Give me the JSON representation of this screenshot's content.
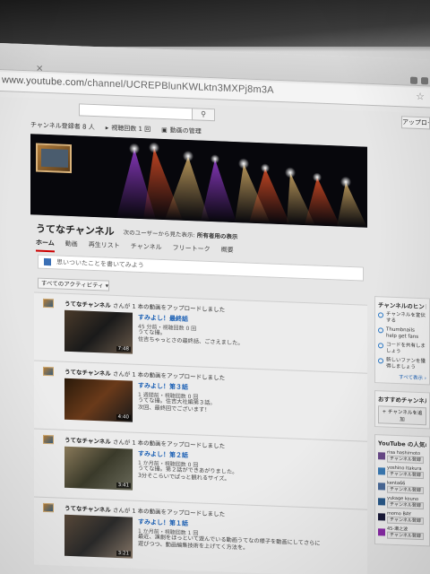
{
  "browser": {
    "url_host": "www.youtube.com",
    "url_path": "/channel/UCREPBlunKWLktn3MXPj8m3A"
  },
  "header": {
    "upload_label": "アップロー"
  },
  "channel_stats": {
    "subscribers_label": "チャンネル登録者 8 人",
    "views_label": "視聴回数 1 回",
    "manage_videos_label": "動画の管理"
  },
  "channel": {
    "name": "うてなチャンネル",
    "view_as_prefix": "次のユーザーから見た表示:",
    "view_as_value": "所有者用の表示"
  },
  "nav": {
    "tabs": [
      {
        "label": "ホーム",
        "active": true
      },
      {
        "label": "動画",
        "active": false
      },
      {
        "label": "再生リスト",
        "active": false
      },
      {
        "label": "チャンネル",
        "active": false
      },
      {
        "label": "フリートーク",
        "active": false
      },
      {
        "label": "概要",
        "active": false
      }
    ]
  },
  "post_box": {
    "placeholder": "思いついたことを書いてみよう"
  },
  "activity_filter": {
    "label": "すべてのアクティビティ ▾"
  },
  "feed": [
    {
      "channel": "うてなチャンネル",
      "action": " さんが 1 本の動画をアップロードしました",
      "title": "すみよし！最終話",
      "meta": "45 分前・視聴回数 0 回",
      "desc": "うてな撮。\n住吉ちゃっとさの最終話、ごさえました。",
      "duration": "7:48"
    },
    {
      "channel": "うてなチャンネル",
      "action": " さんが 1 本の動画をアップロードしました",
      "title": "すみよし！第３話",
      "meta": "1 週間前・視聴回数 0 回",
      "desc": "うてな撮。住吉大社編第３話。\n次回、最終回でございます！",
      "duration": "4:40"
    },
    {
      "channel": "うてなチャンネル",
      "action": " さんが 1 本の動画をアップロードしました",
      "title": "すみよし！第２話",
      "meta": "1 か月前・視聴回数 0 回",
      "desc": "うてな撮。第２話ができあがりました。\n3分そこらいでぱっと観れるサイズ。",
      "duration": "3:41"
    },
    {
      "channel": "うてなチャンネル",
      "action": " さんが 1 本の動画をアップロードしました",
      "title": "すみよし！第１話",
      "meta": "1 か月前・視聴回数 1 回",
      "desc": "最近、演劇をほっといて遊んでいる動画うてなの様子を動画にしてさらに\n遊びつつ、動画編集技術を上げてく方法を。",
      "duration": "3:21"
    }
  ],
  "sidebar": {
    "hints_title": "チャンネルのヒント",
    "hints": [
      "チャンネルを宣伝する",
      "Thumbnails help get fans",
      "コードを共有しましょう",
      "新しいファンを獲得しましょう"
    ],
    "hints_more": "すべて表示 ›",
    "featured_title": "おすすめチャンネル",
    "add_channel_label": "+ チャンネルを追加",
    "popular_title": "YouTube の人気のチャンネル",
    "popular": [
      {
        "name": "risa hashimoto",
        "sub": "チャンネル登録"
      },
      {
        "name": "yoshino Itakura",
        "sub": "チャンネル登録"
      },
      {
        "name": "kenta66",
        "sub": "チャンネル登録"
      },
      {
        "name": "yukage kouno",
        "sub": "チャンネル登録"
      },
      {
        "name": "momo BAY",
        "sub": "チャンネル登録"
      },
      {
        "name": "45-瀬之波",
        "sub": "チャンネル登録"
      }
    ]
  }
}
